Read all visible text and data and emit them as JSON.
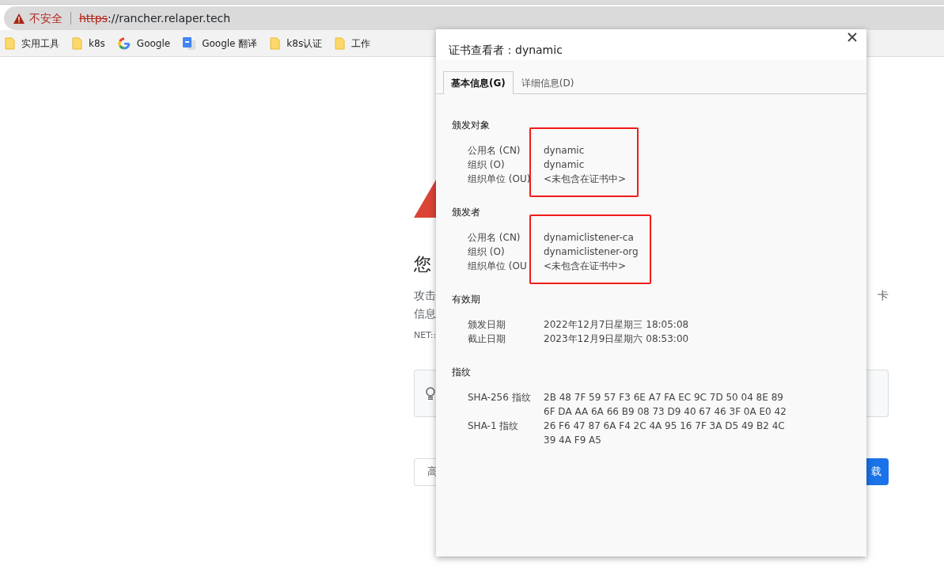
{
  "browser": {
    "security_label": "不安全",
    "url_scheme": "https",
    "url_rest": "://rancher.relaper.tech"
  },
  "bookmarks": [
    {
      "label": "实用工具",
      "kind": "folder"
    },
    {
      "label": "k8s",
      "kind": "folder"
    },
    {
      "label": "Google",
      "kind": "google"
    },
    {
      "label": "Google 翻译",
      "kind": "translate"
    },
    {
      "label": "k8s认证",
      "kind": "folder"
    },
    {
      "label": "工作",
      "kind": "folder"
    }
  ],
  "background_page": {
    "heading": "您",
    "paragraph_lines": [
      "攻击",
      "信息"
    ],
    "right_fragment": "卡",
    "error_code": "NET::",
    "left_button": "高",
    "right_button": "载"
  },
  "dialog": {
    "title": "证书查看者：dynamic",
    "tabs": [
      {
        "label": "基本信息(G)",
        "selected": true
      },
      {
        "label": "详细信息(D)",
        "selected": false
      }
    ],
    "sections": [
      {
        "heading": "颁发对象",
        "highlighted": true,
        "rows": [
          {
            "label": "公用名 (CN)",
            "lines": [
              "dynamic"
            ]
          },
          {
            "label": "组织 (O)",
            "lines": [
              "dynamic"
            ]
          },
          {
            "label": "组织单位 (OU)",
            "lines": [
              "<未包含在证书中>"
            ]
          }
        ]
      },
      {
        "heading": "颁发者",
        "highlighted": true,
        "rows": [
          {
            "label": "公用名 (CN)",
            "lines": [
              "dynamiclistener-ca"
            ]
          },
          {
            "label": "组织 (O)",
            "lines": [
              "dynamiclistener-org"
            ]
          },
          {
            "label": "组织单位 (OU",
            "lines": [
              "<未包含在证书中>"
            ]
          }
        ]
      },
      {
        "heading": "有效期",
        "highlighted": false,
        "rows": [
          {
            "label": "颁发日期",
            "lines": [
              "2022年12月7日星期三 18:05:08"
            ]
          },
          {
            "label": "截止日期",
            "lines": [
              "2023年12月9日星期六 08:53:00"
            ]
          }
        ]
      },
      {
        "heading": "指纹",
        "highlighted": false,
        "rows": [
          {
            "label": "SHA-256 指纹",
            "lines": [
              "2B 48 7F 59 57 F3 6E A7 FA EC 9C 7D 50 04 8E 89",
              "6F DA AA 6A 66 B9 08 73 D9 40 67 46 3F 0A E0 42"
            ]
          },
          {
            "label": "SHA-1 指纹",
            "lines": [
              "26 F6 47 87 6A F4 2C 4A 95 16 7F 3A D5 49 B2 4C",
              "39 4A F9 A5"
            ]
          }
        ]
      }
    ]
  }
}
